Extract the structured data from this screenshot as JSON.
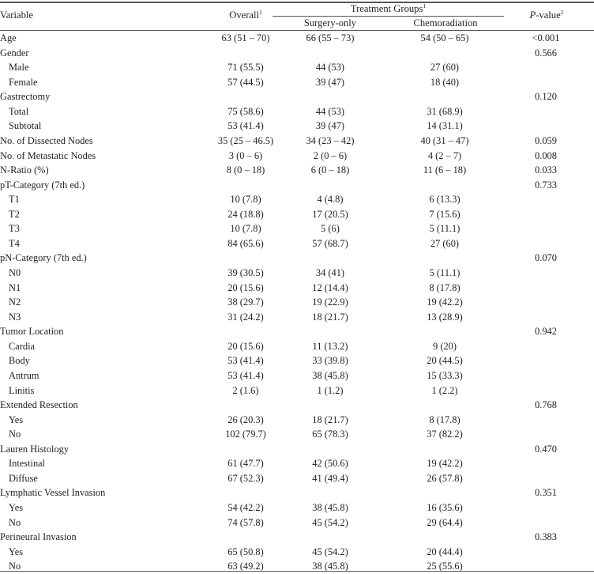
{
  "table": {
    "header": {
      "variable": "Variable",
      "overall": "Overall",
      "overall_sup": "1",
      "treatment_groups": "Treatment Groups",
      "treatment_groups_sup": "1",
      "surgery_only": "Surgery-only",
      "chemoradiation": "Chemoradiation",
      "pvalue_italic": "P",
      "pvalue_rest": "-value",
      "pvalue_sup": "2"
    },
    "rows": [
      {
        "variable": "Age",
        "indent": false,
        "overall": "63 (51 – 70)",
        "surgery": "66 (55 – 73)",
        "chemo": "54 (50 – 65)",
        "pvalue": "<0.001"
      },
      {
        "variable": "Gender",
        "indent": false,
        "overall": "",
        "surgery": "",
        "chemo": "",
        "pvalue": "0.566"
      },
      {
        "variable": "Male",
        "indent": true,
        "overall": "71 (55.5)",
        "surgery": "44 (53)",
        "chemo": "27 (60)",
        "pvalue": ""
      },
      {
        "variable": "Female",
        "indent": true,
        "overall": "57 (44.5)",
        "surgery": "39 (47)",
        "chemo": "18 (40)",
        "pvalue": ""
      },
      {
        "variable": "Gastrectomy",
        "indent": false,
        "overall": "",
        "surgery": "",
        "chemo": "",
        "pvalue": "0.120"
      },
      {
        "variable": "Total",
        "indent": true,
        "overall": "75 (58.6)",
        "surgery": "44 (53)",
        "chemo": "31 (68.9)",
        "pvalue": ""
      },
      {
        "variable": "Subtotal",
        "indent": true,
        "overall": "53 (41.4)",
        "surgery": "39 (47)",
        "chemo": "14 (31.1)",
        "pvalue": ""
      },
      {
        "variable": "No. of Dissected Nodes",
        "indent": false,
        "overall": "35 (25 – 46.5)",
        "surgery": "34 (23 – 42)",
        "chemo": "40 (31 – 47)",
        "pvalue": "0.059"
      },
      {
        "variable": "No. of Metastatic Nodes",
        "indent": false,
        "overall": "3 (0 – 6)",
        "surgery": "2 (0 – 6)",
        "chemo": "4 (2 – 7)",
        "pvalue": "0.008"
      },
      {
        "variable": "N-Ratio (%)",
        "indent": false,
        "overall": "8 (0 – 18)",
        "surgery": "6 (0 – 18)",
        "chemo": "11 (6 – 18)",
        "pvalue": "0.033"
      },
      {
        "variable": "pT-Category (7th ed.)",
        "indent": false,
        "overall": "",
        "surgery": "",
        "chemo": "",
        "pvalue": "0.733"
      },
      {
        "variable": "T1",
        "indent": true,
        "overall": "10 (7.8)",
        "surgery": "4 (4.8)",
        "chemo": "6 (13.3)",
        "pvalue": ""
      },
      {
        "variable": "T2",
        "indent": true,
        "overall": "24 (18.8)",
        "surgery": "17 (20.5)",
        "chemo": "7 (15.6)",
        "pvalue": ""
      },
      {
        "variable": "T3",
        "indent": true,
        "overall": "10 (7.8)",
        "surgery": "5 (6)",
        "chemo": "5 (11.1)",
        "pvalue": ""
      },
      {
        "variable": "T4",
        "indent": true,
        "overall": "84 (65.6)",
        "surgery": "57 (68.7)",
        "chemo": "27 (60)",
        "pvalue": ""
      },
      {
        "variable": "pN-Category (7th ed.)",
        "indent": false,
        "overall": "",
        "surgery": "",
        "chemo": "",
        "pvalue": "0.070"
      },
      {
        "variable": "N0",
        "indent": true,
        "overall": "39 (30.5)",
        "surgery": "34 (41)",
        "chemo": "5 (11.1)",
        "pvalue": ""
      },
      {
        "variable": "N1",
        "indent": true,
        "overall": "20 (15.6)",
        "surgery": "12 (14.4)",
        "chemo": "8 (17.8)",
        "pvalue": ""
      },
      {
        "variable": "N2",
        "indent": true,
        "overall": "38 (29.7)",
        "surgery": "19 (22.9)",
        "chemo": "19 (42.2)",
        "pvalue": ""
      },
      {
        "variable": "N3",
        "indent": true,
        "overall": "31 (24.2)",
        "surgery": "18 (21.7)",
        "chemo": "13 (28.9)",
        "pvalue": ""
      },
      {
        "variable": "Tumor Location",
        "indent": false,
        "overall": "",
        "surgery": "",
        "chemo": "",
        "pvalue": "0.942"
      },
      {
        "variable": "Cardia",
        "indent": true,
        "overall": "20 (15.6)",
        "surgery": "11 (13.2)",
        "chemo": "9 (20)",
        "pvalue": ""
      },
      {
        "variable": "Body",
        "indent": true,
        "overall": "53 (41.4)",
        "surgery": "33 (39.8)",
        "chemo": "20 (44.5)",
        "pvalue": ""
      },
      {
        "variable": "Antrum",
        "indent": true,
        "overall": "53 (41.4)",
        "surgery": "38 (45.8)",
        "chemo": "15 (33.3)",
        "pvalue": ""
      },
      {
        "variable": "Linitis",
        "indent": true,
        "overall": "2 (1.6)",
        "surgery": "1 (1.2)",
        "chemo": "1 (2.2)",
        "pvalue": ""
      },
      {
        "variable": "Extended Resection",
        "indent": false,
        "overall": "",
        "surgery": "",
        "chemo": "",
        "pvalue": "0.768"
      },
      {
        "variable": "Yes",
        "indent": true,
        "overall": "26 (20.3)",
        "surgery": "18 (21.7)",
        "chemo": "8 (17.8)",
        "pvalue": ""
      },
      {
        "variable": "No",
        "indent": true,
        "overall": "102 (79.7)",
        "surgery": "65 (78.3)",
        "chemo": "37 (82.2)",
        "pvalue": ""
      },
      {
        "variable": "Lauren Histology",
        "indent": false,
        "overall": "",
        "surgery": "",
        "chemo": "",
        "pvalue": "0.470"
      },
      {
        "variable": "Intestinal",
        "indent": true,
        "overall": "61 (47.7)",
        "surgery": "42 (50.6)",
        "chemo": "19 (42.2)",
        "pvalue": ""
      },
      {
        "variable": "Diffuse",
        "indent": true,
        "overall": "67 (52.3)",
        "surgery": "41 (49.4)",
        "chemo": "26 (57.8)",
        "pvalue": ""
      },
      {
        "variable": "Lymphatic Vessel Invasion",
        "indent": false,
        "overall": "",
        "surgery": "",
        "chemo": "",
        "pvalue": "0.351"
      },
      {
        "variable": "Yes",
        "indent": true,
        "overall": "54 (42.2)",
        "surgery": "38 (45.8)",
        "chemo": "16 (35.6)",
        "pvalue": ""
      },
      {
        "variable": "No",
        "indent": true,
        "overall": "74 (57.8)",
        "surgery": "45 (54.2)",
        "chemo": "29 (64.4)",
        "pvalue": ""
      },
      {
        "variable": "Perineural Invasion",
        "indent": false,
        "overall": "",
        "surgery": "",
        "chemo": "",
        "pvalue": "0.383"
      },
      {
        "variable": "Yes",
        "indent": true,
        "overall": "65 (50.8)",
        "surgery": "45 (54.2)",
        "chemo": "20 (44.4)",
        "pvalue": ""
      },
      {
        "variable": "No",
        "indent": true,
        "overall": "63 (49.2)",
        "surgery": "38 (45.8)",
        "chemo": "25 (55.6)",
        "pvalue": ""
      }
    ]
  },
  "colors": {
    "rule": "#58595b",
    "text": "#231f20",
    "background": "#ffffff"
  }
}
